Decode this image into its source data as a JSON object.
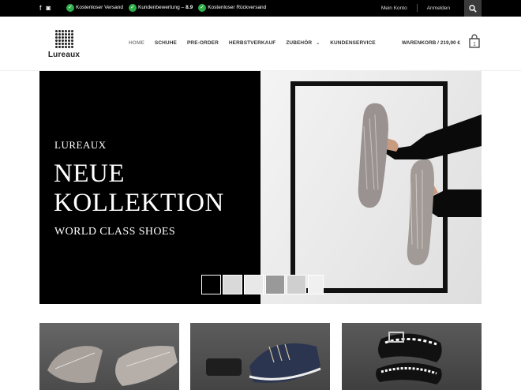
{
  "topbar": {
    "social": [
      {
        "icon": "facebook-icon",
        "glyph": "f"
      },
      {
        "icon": "instagram-icon",
        "glyph": "◙"
      }
    ],
    "usps": [
      {
        "text": "Kostenloser Versand"
      },
      {
        "text": "Kundenbewertung – ",
        "bold": "8.9"
      },
      {
        "text": "Kostenloser Rückversand"
      }
    ],
    "links": {
      "account": "Mein Konto",
      "login": "Anmelden"
    },
    "search_icon": "search-icon"
  },
  "header": {
    "logo_text": "Lureaux",
    "nav": [
      "HOME",
      "SCHUHE",
      "PRE-ORDER",
      "HERBSTVERKAUF",
      "ZUBEHÖR",
      "KUNDENSERVICE"
    ],
    "nav_dropdown_index": 4,
    "cart_label": "WARENKORB / 219,90 €",
    "cart_count": "1"
  },
  "hero": {
    "brand": "LUREAUX",
    "headline_line1": "NEUE",
    "headline_line2": "KOLLEKTION",
    "subline": "WORLD CLASS SHOES",
    "thumbnails": 6,
    "active_thumbnail": 1
  },
  "tiles": [
    {
      "subject": "shoes-icon"
    },
    {
      "subject": "sneaker-icon"
    },
    {
      "subject": "belt-icon"
    }
  ],
  "colors": {
    "topbar": "#000000",
    "usp_check": "#2eae4b",
    "hero_dark": "#000000"
  }
}
